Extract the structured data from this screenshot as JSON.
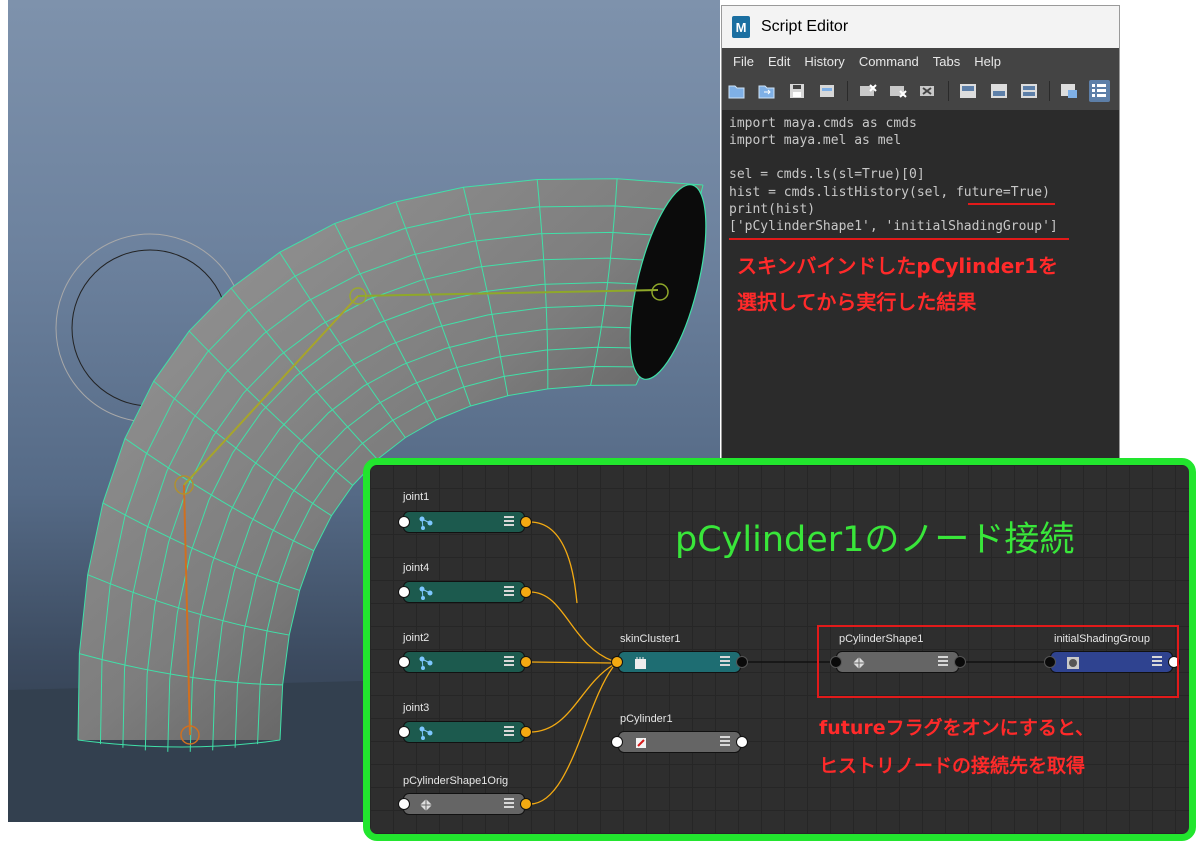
{
  "script_editor": {
    "title": "Script Editor",
    "logo_text": "M",
    "menu": [
      "File",
      "Edit",
      "History",
      "Command",
      "Tabs",
      "Help"
    ],
    "toolbar_icons": [
      "open-script-icon",
      "source-script-icon",
      "save-script-icon",
      "save-to-shelf-icon",
      "clear-history-icon",
      "clear-input-icon",
      "clear-all-icon",
      "show-history-only-icon",
      "show-input-only-icon",
      "show-both-icon",
      "echo-commands-icon",
      "line-numbers-icon"
    ],
    "code_lines": [
      "import maya.cmds as cmds",
      "import maya.mel as mel",
      "",
      "sel = cmds.ls(sl=True)[0]",
      "hist = cmds.listHistory(sel, future=True)",
      "print(hist)",
      "['pCylinderShape1', 'initialShadingGroup']"
    ],
    "note_line1": "スキンバインドしたpCylinder1を",
    "note_line2": "選択してから実行した結果"
  },
  "node_editor": {
    "title": "pCylinder1のノード接続",
    "nodes": {
      "joint1": "joint1",
      "joint4": "joint4",
      "joint2": "joint2",
      "joint3": "joint3",
      "orig": "pCylinderShape1Orig",
      "skin": "skinCluster1",
      "transform": "pCylinder1",
      "shape": "pCylinderShape1",
      "sg": "initialShadingGroup"
    },
    "note_line1": "futureフラグをオンにすると、",
    "note_line2": "ヒストリノードの接続先を取得"
  },
  "colors": {
    "annotation_red": "#ff2a2a",
    "highlight_green": "#22e62e",
    "wire_orange": "#f3aa12",
    "mesh_wire": "#40e0a8",
    "joint_node": "#1c5a4e",
    "skin_node": "#1e6d72",
    "shading_group_node": "#2f4390"
  }
}
